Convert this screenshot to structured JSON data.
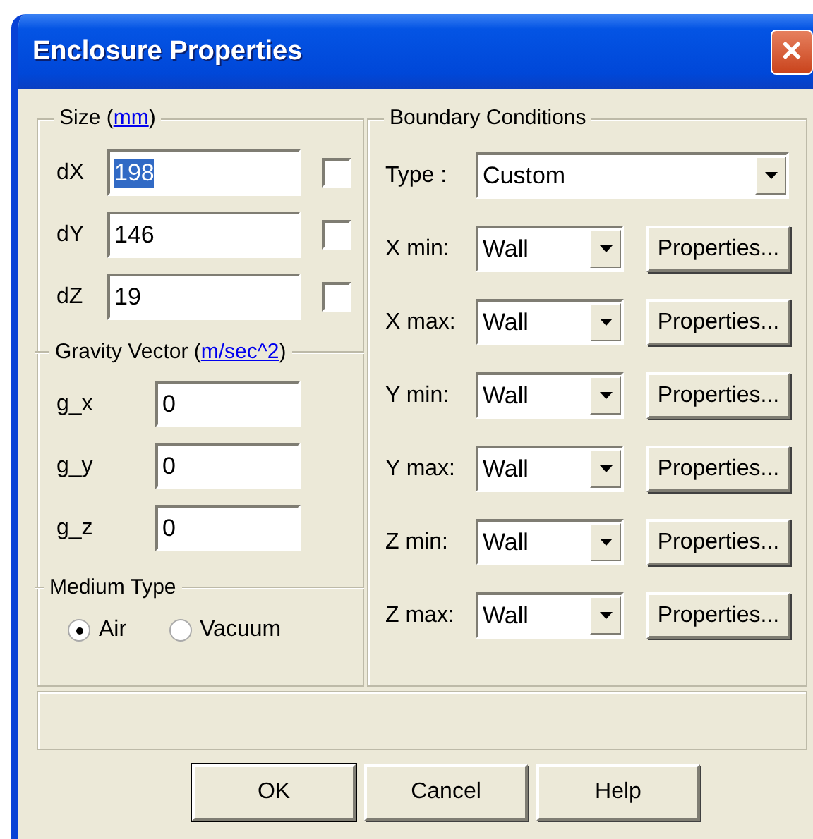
{
  "window": {
    "title": "Enclosure Properties",
    "close": "✕"
  },
  "size": {
    "legend": "Size (",
    "unit": "mm",
    "legend_end": ")",
    "rows": [
      {
        "label": "dX",
        "value": "198",
        "value_selected": true,
        "checked": false
      },
      {
        "label": "dY",
        "value": "146",
        "value_selected": false,
        "checked": false
      },
      {
        "label": "dZ",
        "value": "19",
        "value_selected": false,
        "checked": false
      }
    ]
  },
  "gravity": {
    "legend": "Gravity Vector (",
    "unit": "m/sec^2",
    "legend_end": ")",
    "rows": [
      {
        "label": "g_x",
        "value": "0"
      },
      {
        "label": "g_y",
        "value": "0"
      },
      {
        "label": "g_z",
        "value": "0"
      }
    ]
  },
  "medium": {
    "legend": "Medium Type",
    "options": [
      {
        "label": "Air",
        "selected": true
      },
      {
        "label": "Vacuum",
        "selected": false
      }
    ]
  },
  "boundary": {
    "legend": "Boundary Conditions",
    "type_label": "Type :",
    "type_value": "Custom",
    "rows": [
      {
        "label": "X min:",
        "value": "Wall",
        "button": "Properties..."
      },
      {
        "label": "X max:",
        "value": "Wall",
        "button": "Properties..."
      },
      {
        "label": "Y min:",
        "value": "Wall",
        "button": "Properties..."
      },
      {
        "label": "Y max:",
        "value": "Wall",
        "button": "Properties..."
      },
      {
        "label": "Z min:",
        "value": "Wall",
        "button": "Properties..."
      },
      {
        "label": "Z max:",
        "value": "Wall",
        "button": "Properties..."
      }
    ]
  },
  "buttons": [
    {
      "label": "OK",
      "default": true
    },
    {
      "label": "Cancel",
      "default": false
    },
    {
      "label": "Help",
      "default": false
    }
  ]
}
